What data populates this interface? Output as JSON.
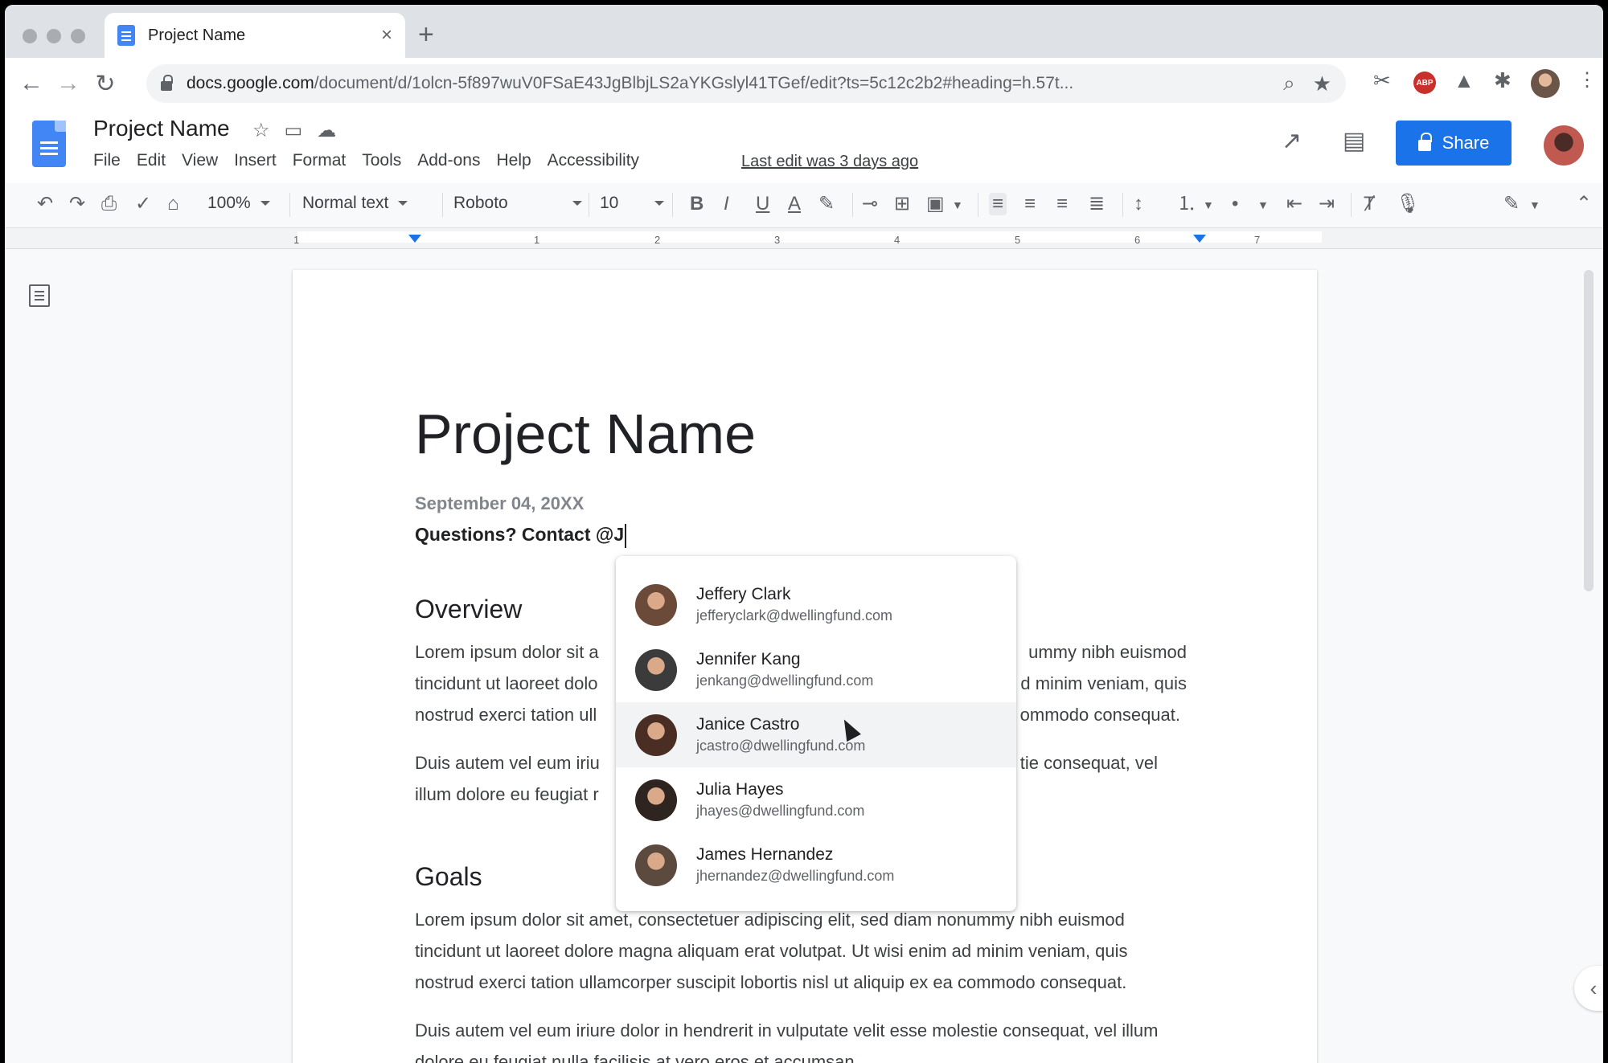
{
  "browser": {
    "tab_title": "Project Name",
    "tab_close": "×",
    "new_tab": "+",
    "url_host": "docs.google.com",
    "url_path": "/document/d/1olcn-5f897wuV0FSaE43JgBlbjLS2aYKGslyl41TGef/edit?ts=5c12c2b2#heading=h.57t...",
    "extensions": [
      "scissors-icon",
      "adblock-icon",
      "drive-icon",
      "puzzle-icon"
    ],
    "abp_label": "ABP"
  },
  "docs": {
    "title": "Project Name",
    "menu": [
      "File",
      "Edit",
      "View",
      "Insert",
      "Format",
      "Tools",
      "Add-ons",
      "Help",
      "Accessibility"
    ],
    "last_edit": "Last edit was 3 days ago",
    "share_label": "Share"
  },
  "toolbar": {
    "zoom": "100%",
    "style": "Normal text",
    "font": "Roboto",
    "size": "10"
  },
  "ruler": {
    "numbers": [
      "1",
      "1",
      "2",
      "3",
      "4",
      "5",
      "6",
      "7"
    ]
  },
  "document": {
    "title": "Project Name",
    "date": "September 04, 20XX",
    "question": "Questions? Contact @J",
    "overview_heading": "Overview",
    "overview_p1_l1_a": "Lorem ipsum dolor sit a",
    "overview_p1_l1_b": "ummy nibh euismod",
    "overview_p1_l2_a": "tincidunt ut laoreet dolo",
    "overview_p1_l2_b": "d minim veniam, quis",
    "overview_p1_l3_a": "nostrud exerci tation ull",
    "overview_p1_l3_b": "ommodo consequat.",
    "overview_p2_l1_a": "Duis autem vel eum iriu",
    "overview_p2_l1_b": "tie consequat, vel",
    "overview_p2_l2_a": "illum dolore eu feugiat r",
    "goals_heading": "Goals",
    "goals_p1": "Lorem ipsum dolor sit amet, consectetuer adipiscing elit, sed diam nonummy nibh euismod tincidunt ut laoreet dolore magna aliquam erat volutpat. Ut wisi enim ad minim veniam, quis nostrud exerci tation ullamcorper suscipit lobortis nisl ut aliquip ex ea commodo consequat.",
    "goals_p2": "Duis autem vel eum iriure dolor in hendrerit in vulputate velit esse molestie consequat, vel illum dolore eu feugiat nulla facilisis at vero eros et accumsan."
  },
  "mentions": [
    {
      "name": "Jeffery Clark",
      "email": "jefferyclark@dwellingfund.com",
      "avatar_color": "#6b4a3a",
      "hovered": false
    },
    {
      "name": "Jennifer Kang",
      "email": "jenkang@dwellingfund.com",
      "avatar_color": "#3b3b3b",
      "hovered": false
    },
    {
      "name": "Janice Castro",
      "email": "jcastro@dwellingfund.com",
      "avatar_color": "#4a2e24",
      "hovered": true
    },
    {
      "name": "Julia Hayes",
      "email": "jhayes@dwellingfund.com",
      "avatar_color": "#2e2420",
      "hovered": false
    },
    {
      "name": "James Hernandez",
      "email": "jhernandez@dwellingfund.com",
      "avatar_color": "#5c4a3e",
      "hovered": false
    }
  ],
  "colors": {
    "accent": "#1a73e8",
    "docs_blue": "#4285f4"
  }
}
